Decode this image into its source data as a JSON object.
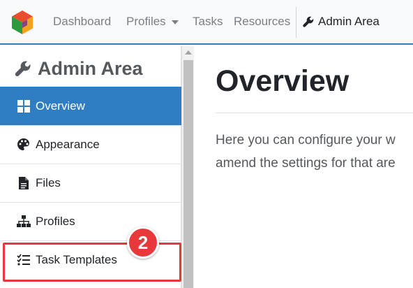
{
  "navbar": {
    "items": [
      {
        "label": "Dashboard"
      },
      {
        "label": "Profiles"
      },
      {
        "label": "Tasks"
      },
      {
        "label": "Resources"
      }
    ],
    "admin_label": "Admin Area",
    "accent_color": "#2f7dc3"
  },
  "sidebar": {
    "title": "Admin Area",
    "items": [
      {
        "label": "Overview",
        "icon": "windows-grid-icon",
        "active": true
      },
      {
        "label": "Appearance",
        "icon": "palette-icon",
        "active": false
      },
      {
        "label": "Files",
        "icon": "file-icon",
        "active": false
      },
      {
        "label": "Profiles",
        "icon": "sitemap-icon",
        "active": false
      },
      {
        "label": "Task Templates",
        "icon": "tasks-list-icon",
        "active": false
      }
    ]
  },
  "main": {
    "title": "Overview",
    "text_lines": [
      "Here you can configure your w",
      "amend the settings for that are"
    ]
  },
  "annotation": {
    "step": "2",
    "color": "#e8383b"
  }
}
